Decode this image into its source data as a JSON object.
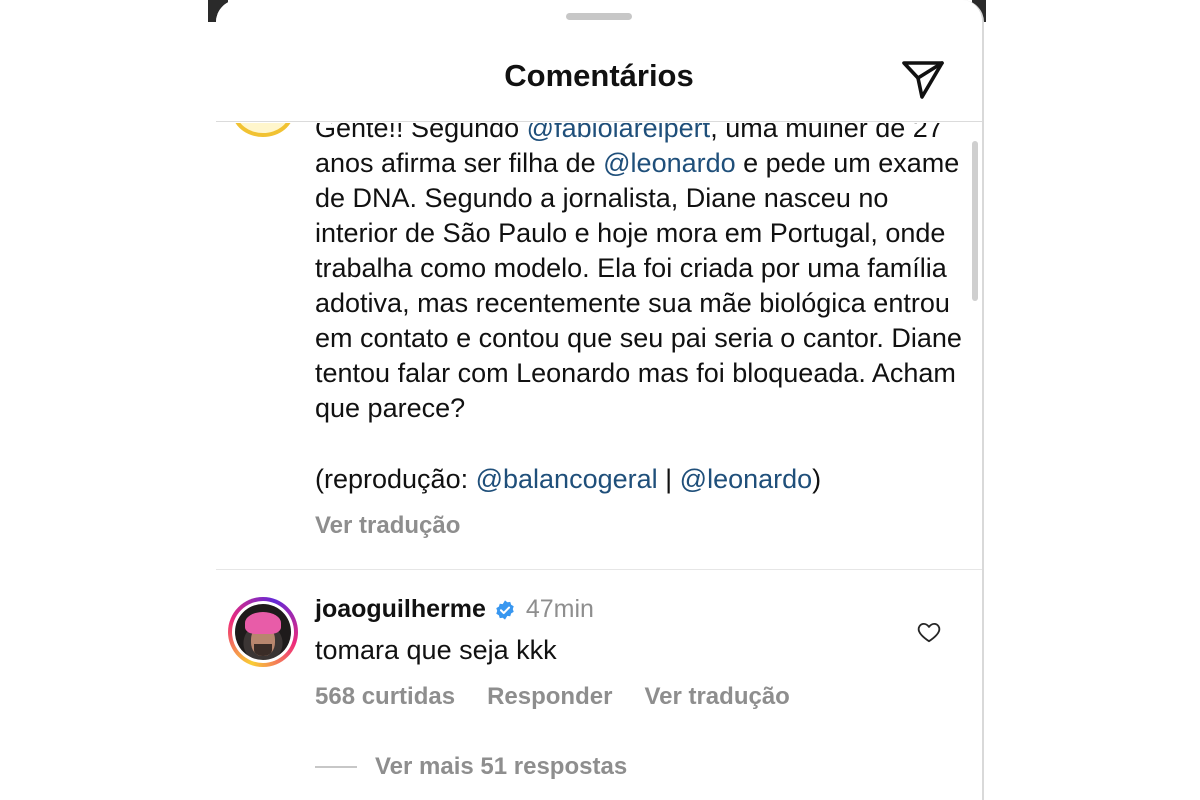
{
  "header": {
    "title": "Comentários",
    "share_icon": "send-icon"
  },
  "caption": {
    "line_partial": "Gente!! Segundo ",
    "mention_1": "@fabiolareipert",
    "text_after_mention_1": ", uma mulher de 27 anos afirma ser filha de ",
    "mention_2": "@leonardo",
    "text_body": " e pede um exame de DNA. Segundo a jornalista, Diane nasceu no interior de São Paulo e hoje mora em Portugal, onde trabalha como modelo. Ela foi criada por uma família adotiva, mas recentemente sua mãe biológica entrou em contato e contou que seu pai seria o cantor. Diane tentou falar com Leonardo mas foi bloqueada. Acham que parece?",
    "credit_prefix": "(reprodução: ",
    "credit_mention_1": "@balancogeral",
    "credit_separator": " | ",
    "credit_mention_2": "@leonardo",
    "credit_suffix": ")",
    "translate_label": "Ver tradução"
  },
  "comment": {
    "username": "joaoguilherme",
    "verified_icon": "verified-badge-icon",
    "timestamp": "47min",
    "text": "tomara que seja kkk",
    "likes_label": "568 curtidas",
    "reply_label": "Responder",
    "translate_label": "Ver tradução",
    "more_replies_label": "Ver mais 51 respostas",
    "like_icon": "heart-outline-icon"
  },
  "colors": {
    "mention": "#1f4f7a",
    "muted": "#8e8e8e",
    "verified": "#3897f0",
    "divider": "#dbdbdb"
  }
}
